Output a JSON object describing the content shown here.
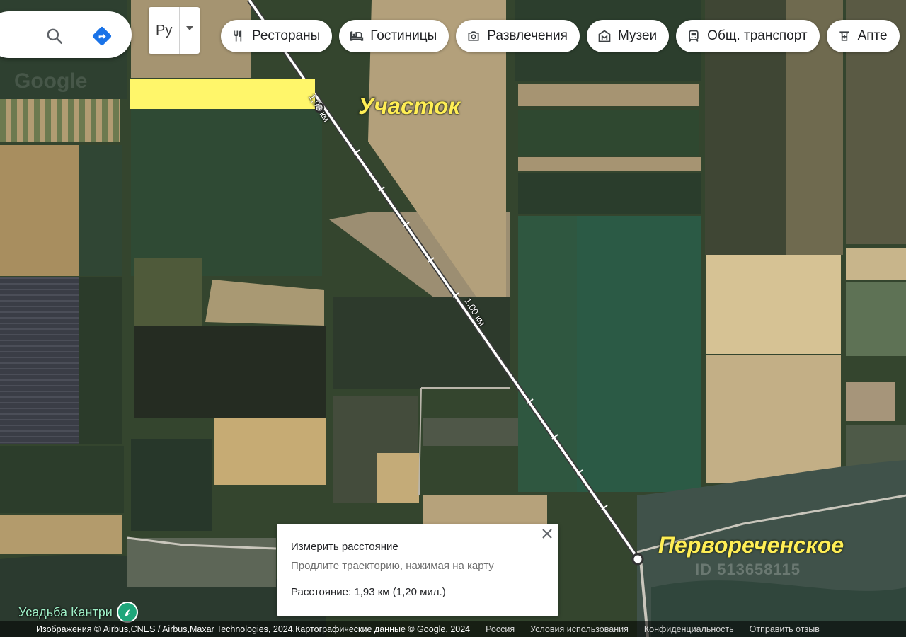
{
  "search": {
    "search_icon": "search-icon",
    "directions_icon": "directions-icon"
  },
  "language": {
    "value": "Ру"
  },
  "chips": [
    {
      "label": "Рестораны",
      "icon": "restaurant-icon"
    },
    {
      "label": "Гостиницы",
      "icon": "hotel-icon"
    },
    {
      "label": "Развлечения",
      "icon": "camera-icon"
    },
    {
      "label": "Музеи",
      "icon": "museum-icon"
    },
    {
      "label": "Общ. транспорт",
      "icon": "transit-icon"
    },
    {
      "label": "Апте",
      "icon": "pharmacy-icon"
    }
  ],
  "map": {
    "labels": {
      "plot": "Участок",
      "village": "Первореченское",
      "seg_total": "1,93 км",
      "seg_mid": "1,00 км",
      "watermark": "ID 513658115",
      "google_watermark": "Google"
    }
  },
  "measure": {
    "title": "Измерить расстояние",
    "hint": "Продлите траекторию, нажимая на карту",
    "distance": "Расстояние: 1,93 км (1,20 мил.)"
  },
  "poi": {
    "name": "Усадьба Кантри"
  },
  "footer": {
    "attribution": "Изображения © Airbus,CNES / Airbus,Maxar Technologies, 2024,Картографические данные © Google, 2024",
    "country": "Россия",
    "terms": "Условия использования",
    "privacy": "Конфиденциальность",
    "feedback": "Отправить отзыв"
  },
  "colors": {
    "highlight": "#fff66a",
    "label_yellow": "#ffee55",
    "poi_green": "#1fa67a",
    "directions_blue": "#1a73e8"
  }
}
